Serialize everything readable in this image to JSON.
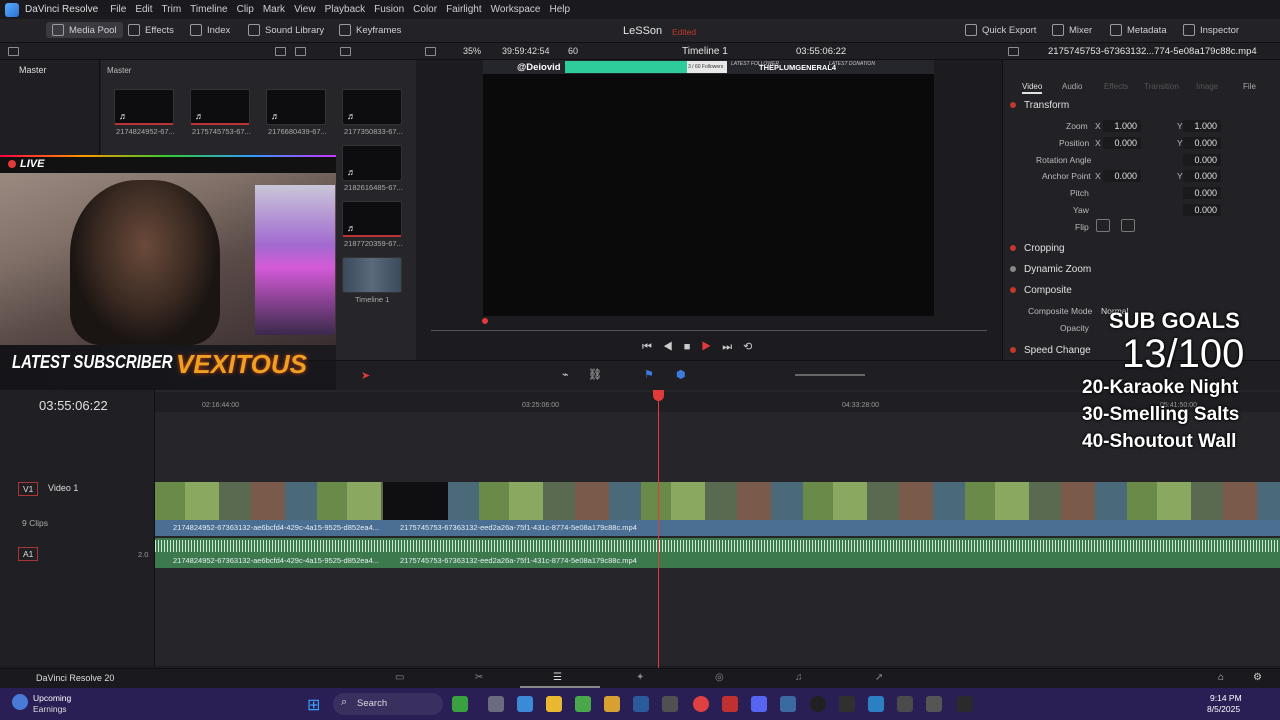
{
  "menubar": {
    "app": "DaVinci Resolve",
    "items": [
      "File",
      "Edit",
      "Trim",
      "Timeline",
      "Clip",
      "Mark",
      "View",
      "Playback",
      "Fusion",
      "Color",
      "Fairlight",
      "Workspace",
      "Help"
    ]
  },
  "toolbar": {
    "media_pool": "Media Pool",
    "effects": "Effects",
    "index": "Index",
    "sound_library": "Sound Library",
    "keyframes": "Keyframes",
    "project": "LeSSon",
    "edited": "Edited",
    "quick_export": "Quick Export",
    "mixer": "Mixer",
    "metadata": "Metadata",
    "inspector": "Inspector"
  },
  "viewerbar": {
    "zoom": "35%",
    "timecode": "39:59:42:54",
    "fps": "60",
    "timeline": "Timeline 1",
    "tc_right": "03:55:06:22",
    "filename": "2175745753-67363132...774-5e08a179c88c.mp4"
  },
  "mediapool": {
    "left_label": "Master",
    "right_label": "Master",
    "clips": [
      "2174824952-67...",
      "2175745753-67...",
      "2176680439-67...",
      "2177350833-67...",
      "2182616485-67...",
      "2187720359-67...",
      "Timeline 1"
    ]
  },
  "overlay": {
    "live": "LIVE",
    "latest_sub": "LATEST SUBSCRIBER",
    "sub_name": "VEXITOUS",
    "goals_title": "SUB GOALS",
    "goals_count": "13/100",
    "goals": [
      "20-Karaoke Night",
      "30-Smelling Salts",
      "40-Shoutout Wall"
    ]
  },
  "viewer_overlay": {
    "handle": "@Deiovid",
    "followers": "3 / 60 Followers",
    "latest_follower": "LATEST FOLLOWER",
    "follower_name": "THEPLUMGENERAL4",
    "donation": "LATEST DONATION"
  },
  "inspector": {
    "tabs": [
      "Video",
      "Audio",
      "Effects",
      "Transition",
      "Image",
      "File"
    ],
    "transform": "Transform",
    "zoom": "Zoom",
    "zoom_x": "1.000",
    "zoom_y": "1.000",
    "position": "Position",
    "pos_x": "0.000",
    "pos_y": "0.000",
    "rotation": "Rotation Angle",
    "rotation_val": "0.000",
    "anchor": "Anchor Point",
    "anchor_x": "0.000",
    "anchor_y": "0.000",
    "pitch": "Pitch",
    "pitch_val": "0.000",
    "yaw": "Yaw",
    "yaw_val": "0.000",
    "flip": "Flip",
    "cropping": "Cropping",
    "dynamic_zoom": "Dynamic Zoom",
    "composite": "Composite",
    "composite_mode": "Composite Mode",
    "composite_mode_val": "Normal",
    "opacity": "Opacity",
    "speed_change": "Speed Change",
    "x": "X",
    "y": "Y"
  },
  "timeline": {
    "timecode": "03:55:06:22",
    "ruler": [
      "02:16:44:00",
      "03:25:06:00",
      "04:33:28:00",
      "05:41:50:00"
    ],
    "v1": "V1",
    "v1_name": "Video 1",
    "clips_count": "9 Clips",
    "a1": "A1",
    "a1_level": "2.0",
    "clip_a": "2174824952-67363132-ae6bcfd4-429c-4a15-9525-d852ea4...",
    "clip_b": "2175745753-67363132-eed2a26a-75f1-431c-8774-5e08a179c88c.mp4"
  },
  "bottombar": {
    "label": "DaVinci Resolve 20"
  },
  "taskbar": {
    "weather_title": "Upcoming",
    "weather_sub": "Earnings",
    "search": "Search",
    "time": "9:14 PM",
    "date": "8/5/2025"
  }
}
